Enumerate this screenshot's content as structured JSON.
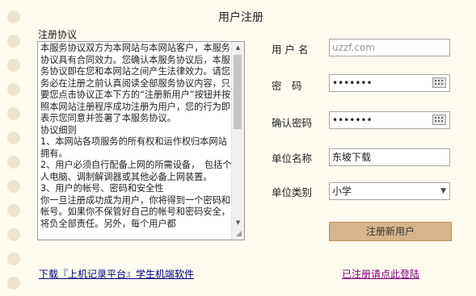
{
  "page": {
    "title": "用户注册"
  },
  "agreement": {
    "label": "注册协议",
    "text": "本服务协议双方为本网站与本网站客户，本服务协议具有合同效力。您确认本服务协议后，本服务协议即在您和本网站之间产生法律效力。请您务必在注册之前认真阅读全部服务协议内容，只要您点击协议正本下方的“注册新用户”按钮并按照本网站注册程序成功注册为用户，您的行为即表示您同意并签署了本服务协议。\n协议细则\n1、本网站各项服务的所有权和运作权归本网站拥有。\n2、用户必须自行配备上网的所需设备，　包括个人电脑、调制解调器或其他必备上网装置。\n3、用户的帐号、密码和安全性\n你一旦注册成功成为用户，你将得到一个密码和帐号。如果你不保管好自己的帐号和密码安全，将负全部责任。另外，每个用户都"
  },
  "form": {
    "username": {
      "label": "用 户 名",
      "placeholder": "uzzf.com"
    },
    "password": {
      "label": "密　码",
      "value": "•••••••",
      "icon": "keyboard-icon"
    },
    "confirm": {
      "label": "确认密码",
      "value": "•••••••",
      "icon": "keyboard-icon"
    },
    "unit_name": {
      "label": "单位名称",
      "value": "东坡下载"
    },
    "unit_type": {
      "label": "单位类别",
      "selected": "小学",
      "icon": "dropdown-arrow-icon"
    },
    "submit_label": "注册新用户"
  },
  "footer": {
    "download_link": "下载『上机记录平台』学生机端软件",
    "login_link": "已注册请点此登陆"
  },
  "colors": {
    "background": "#fdfaf0",
    "button": "#d7b48b",
    "link": "#000080",
    "visited_link": "#800080"
  }
}
